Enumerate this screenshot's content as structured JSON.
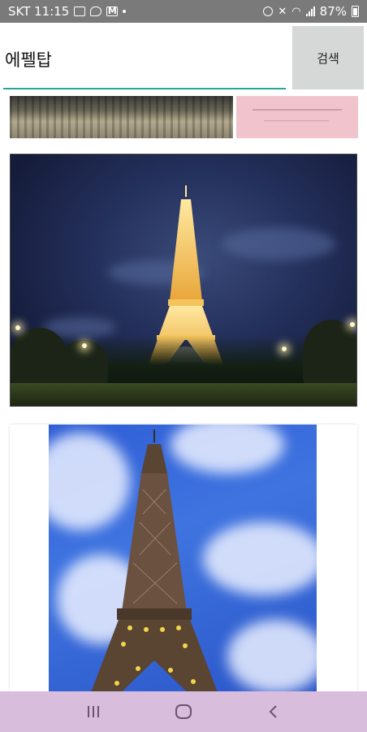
{
  "status_bar": {
    "carrier_time": "SKT 11:15",
    "battery": "87%"
  },
  "search": {
    "query": "에펠탑",
    "button_label": "검색"
  },
  "results": {
    "images": [
      {
        "name": "result-thumbnail-crowd"
      },
      {
        "name": "result-thumbnail-pink-card"
      },
      {
        "name": "result-photo-eiffel-night"
      },
      {
        "name": "result-photo-eiffel-day"
      }
    ]
  },
  "colors": {
    "accent_underline": "#26a69a",
    "search_button_bg": "#d6d7d7",
    "nav_bar_bg": "#d8bedc",
    "status_bar_bg": "#7a7a7a"
  },
  "icons": {
    "nav": [
      "recent-apps-icon",
      "home-icon",
      "back-icon"
    ]
  }
}
